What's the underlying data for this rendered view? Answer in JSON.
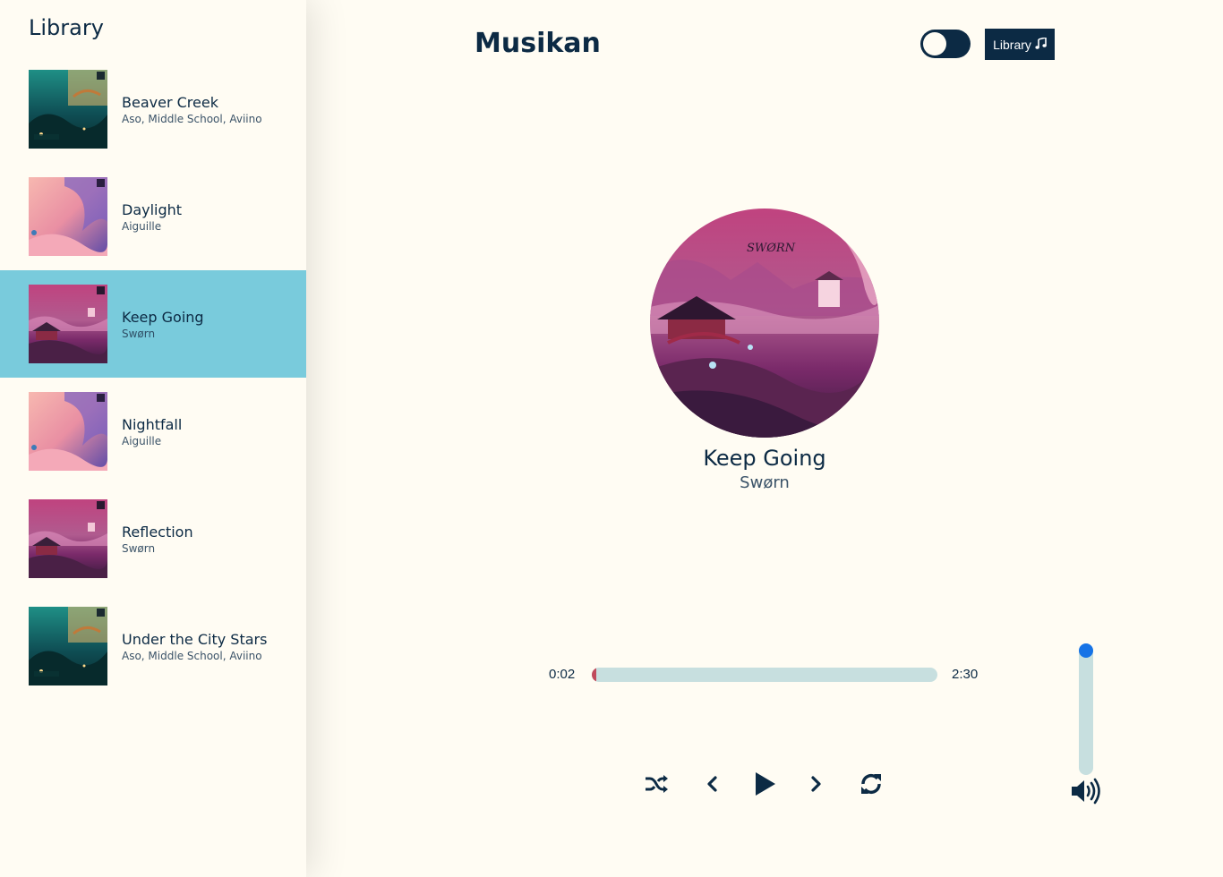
{
  "sidebar": {
    "title": "Library",
    "songs": [
      {
        "name": "Beaver Creek",
        "artist": "Aso, Middle School, Aviino",
        "active": false,
        "cover": "forest"
      },
      {
        "name": "Daylight",
        "artist": "Aiguille",
        "active": false,
        "cover": "pink"
      },
      {
        "name": "Keep Going",
        "artist": "Swørn",
        "active": true,
        "cover": "purple"
      },
      {
        "name": "Nightfall",
        "artist": "Aiguille",
        "active": false,
        "cover": "pink"
      },
      {
        "name": "Reflection",
        "artist": "Swørn",
        "active": false,
        "cover": "purple"
      },
      {
        "name": "Under the City Stars",
        "artist": "Aso, Middle School, Aviino",
        "active": false,
        "cover": "forest"
      }
    ]
  },
  "header": {
    "title": "Musikan",
    "library_button": "Library",
    "library_icon": "music-note-icon",
    "theme_toggle": "off"
  },
  "now_playing": {
    "title": "Keep Going",
    "artist": "Swørn"
  },
  "player": {
    "current_time": "0:02",
    "total_time": "2:30",
    "progress_fraction": 0.013,
    "volume_fraction": 1.0,
    "controls": [
      "shuffle-icon",
      "previous-icon",
      "play-icon",
      "next-icon",
      "repeat-icon"
    ],
    "volume_icon": "volume-icon"
  },
  "colors": {
    "background": "#fffcf3",
    "active_row": "#79cbdc",
    "primary_dark": "#0c2a44",
    "progress_track": "#c7dfdf",
    "progress_fill": "#c04a5c",
    "volume_knob": "#1673e6"
  }
}
